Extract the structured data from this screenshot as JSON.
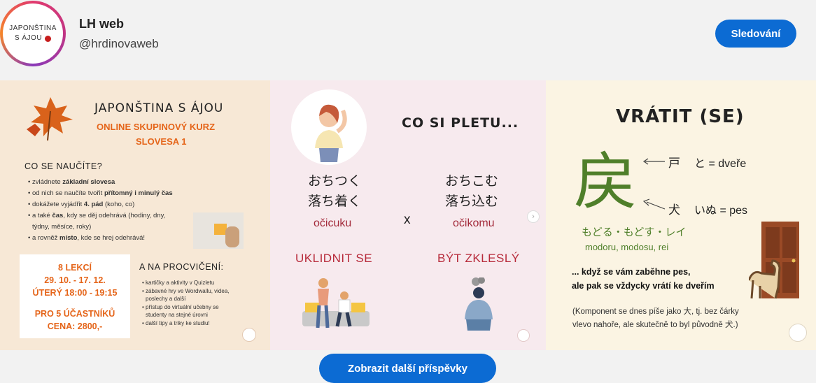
{
  "profile": {
    "avatar_line1": "JAPONŠTINA",
    "avatar_line2": "S ÁJOU",
    "name": "LH web",
    "handle": "@hrdinovaweb",
    "follow_label": "Sledování"
  },
  "post1": {
    "title": "JAPONŠTINA S ÁJOU",
    "subtitle1": "ONLINE SKUPINOVÝ KURZ",
    "subtitle2": "SLOVESA 1",
    "learn_heading": "CO SE NAUČÍTE?",
    "bullets": [
      [
        "• zvládnete ",
        "základní slovesa",
        ""
      ],
      [
        "• od nich se naučíte tvořit ",
        "přítomný i minulý čas",
        ""
      ],
      [
        "• dokážete vyjádřit ",
        "4. pád",
        " (koho, co)"
      ],
      [
        "• a také ",
        "čas",
        ", kdy se děj odehrává (hodiny, dny,"
      ],
      [
        "  týdny, měsíce, roky)",
        "",
        ""
      ],
      [
        "• a rovněž ",
        "místo",
        ", kde se hrej odehrává!"
      ]
    ],
    "box_lessons": "8 LEKCÍ",
    "box_dates": "29. 10. - 17. 12.",
    "box_time": "ÚTERÝ 18:00 - 19:15",
    "box_students": "PRO 5 ÚČASTNÍKŮ",
    "box_price": "CENA: 2800,-",
    "practice_heading": "A NA PROCVIČENÍ:",
    "practice_items": [
      "• kartičky a aktivity v Quizletu",
      "• zábavné hry ve Wordwallu, videa,",
      "  poslechy a další",
      "• přístup do  virtuální učebny se",
      "  studenty na stejné úrovni",
      "• další tipy a triky ke studiu!"
    ]
  },
  "post2": {
    "title": "CO SI PLETU...",
    "left_kana": "おちつく",
    "left_kanji": "落ち着く",
    "left_romaji": "očicuku",
    "x_label": "x",
    "right_kana": "おちこむ",
    "right_kanji": "落ち込む",
    "right_romaji": "očikomu",
    "left_meaning": "UKLIDNIT SE",
    "right_meaning": "BÝT ZKLESLÝ"
  },
  "post3": {
    "title": "VRÁTIT (SE)",
    "kanji": "戻",
    "part1_kanji": "戸",
    "part1_text": "と = dveře",
    "part2_kanji": "犬",
    "part2_text": "いぬ = pes",
    "readings_kana": "もどる・もどす・レイ",
    "readings_romaji": "modoru, modosu, rei",
    "mnemonic1": "... když se vám zaběhne pes,",
    "mnemonic2": "ale pak se vždycky vrátí ke dveřím",
    "note1": "(Komponent se dnes píše jako 大, tj. bez čárky",
    "note2": "vlevo nahoře, ale skutečně to byl původně 犬.)"
  },
  "more_label": "Zobrazit další příspěvky",
  "colors": {
    "accent": "#0c6bd3",
    "orange": "#e5651a",
    "red": "#b72a3a",
    "green": "#4f7f2a"
  }
}
